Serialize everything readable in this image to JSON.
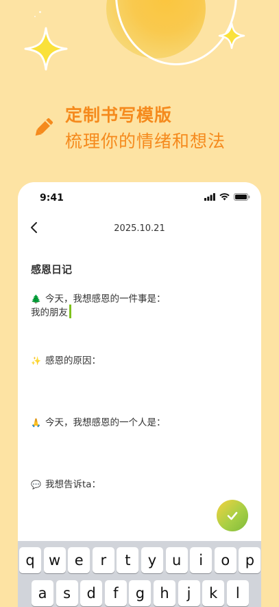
{
  "promo": {
    "line1": "定制书写模版",
    "line2": "梳理你的情绪和想法"
  },
  "status_bar": {
    "time": "9:41"
  },
  "nav": {
    "date": "2025.10.21"
  },
  "journal": {
    "title": "感恩日记",
    "prompts": [
      {
        "emoji": "🌲",
        "text": "今天，我想感恩的一件事是：",
        "answer": "我的朋友"
      },
      {
        "emoji": "✨",
        "text": "感恩的原因：",
        "answer": ""
      },
      {
        "emoji": "🙏",
        "text": "今天，我想感恩的一个人是：",
        "answer": ""
      },
      {
        "emoji": "💬",
        "text": "我想告诉ta：",
        "answer": ""
      }
    ]
  },
  "keyboard": {
    "row1": [
      "q",
      "w",
      "e",
      "r",
      "t",
      "y",
      "u",
      "i",
      "o",
      "p"
    ],
    "row2": [
      "a",
      "s",
      "d",
      "f",
      "g",
      "h",
      "j",
      "k",
      "l"
    ]
  },
  "colors": {
    "background": "#fde3a3",
    "accent_orange": "#f58a1d",
    "caret_green": "#7fc21e"
  },
  "icons": {
    "back": "chevron-left-icon",
    "pencil": "pencil-icon",
    "confirm": "checkmark-icon"
  }
}
